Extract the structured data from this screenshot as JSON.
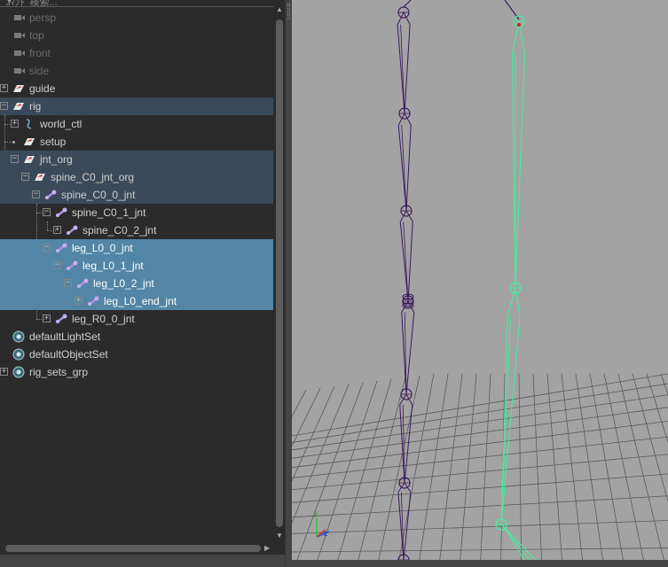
{
  "outliner": {
    "search_placeholder": "ｺﾏﾝﾄﾞ検索...",
    "items": [
      {
        "label": "persp",
        "icon": "camera-icon",
        "indent": 0
      },
      {
        "label": "top",
        "icon": "camera-icon",
        "indent": 0
      },
      {
        "label": "front",
        "icon": "camera-icon",
        "indent": 0
      },
      {
        "label": "side",
        "icon": "camera-icon",
        "indent": 0
      },
      {
        "label": "guide",
        "icon": "transform-icon",
        "indent": 0
      },
      {
        "label": "rig",
        "icon": "transform-icon",
        "indent": 0
      },
      {
        "label": "world_ctl",
        "icon": "curve-icon",
        "indent": 1
      },
      {
        "label": "setup",
        "icon": "transform-icon",
        "indent": 1
      },
      {
        "label": "jnt_org",
        "icon": "transform-icon",
        "indent": 1
      },
      {
        "label": "spine_C0_jnt_org",
        "icon": "transform-icon",
        "indent": 2
      },
      {
        "label": "spine_C0_0_jnt",
        "icon": "joint-icon",
        "indent": 3
      },
      {
        "label": "spine_C0_1_jnt",
        "icon": "joint-icon",
        "indent": 4
      },
      {
        "label": "spine_C0_2_jnt",
        "icon": "joint-icon",
        "indent": 5
      },
      {
        "label": "leg_L0_0_jnt",
        "icon": "joint-icon",
        "indent": 4
      },
      {
        "label": "leg_L0_1_jnt",
        "icon": "joint-icon",
        "indent": 5
      },
      {
        "label": "leg_L0_2_jnt",
        "icon": "joint-icon",
        "indent": 6
      },
      {
        "label": "leg_L0_end_jnt",
        "icon": "joint-icon",
        "indent": 7
      },
      {
        "label": "leg_R0_0_jnt",
        "icon": "joint-icon",
        "indent": 4
      },
      {
        "label": "defaultLightSet",
        "icon": "set-icon",
        "indent": 0
      },
      {
        "label": "defaultObjectSet",
        "icon": "set-icon",
        "indent": 0
      },
      {
        "label": "rig_sets_grp",
        "icon": "set-icon",
        "indent": 0
      }
    ]
  },
  "viewport": {
    "axis_labels": {
      "y": "y",
      "z": "z"
    },
    "colors": {
      "background": "#a3a3a3",
      "grid": "#555555",
      "joint_unselected": "#3a1a5c",
      "joint_selected": "#40f0a0"
    }
  },
  "colors": {
    "outliner_bg": "#2b2b2b",
    "selection_dark": "#3a4a5a",
    "selection_blue": "#5285a6"
  }
}
